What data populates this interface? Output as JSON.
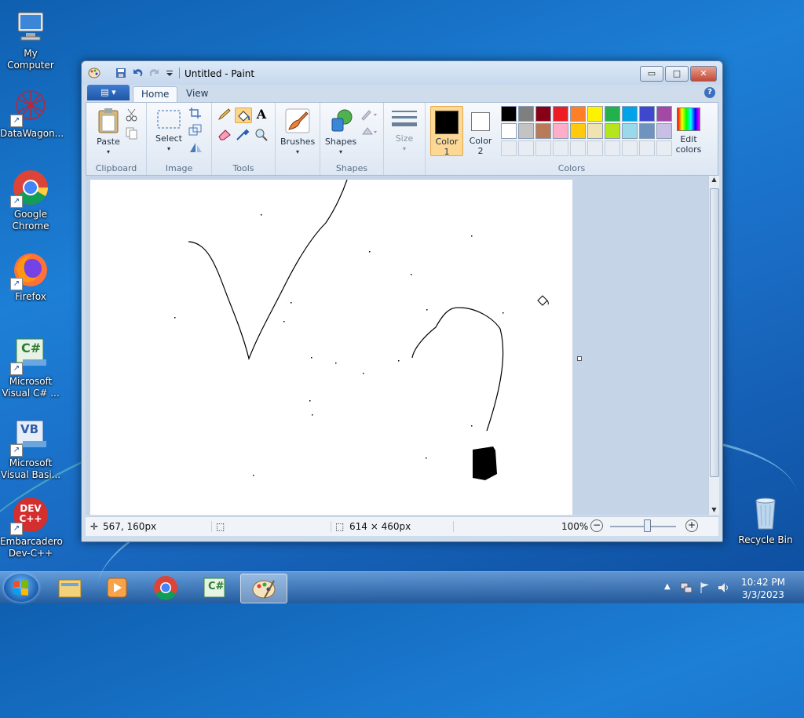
{
  "desktop": {
    "icons": [
      {
        "label": "My Computer",
        "icon": "computer-icon"
      },
      {
        "label": "DataWagon...",
        "icon": "datawagon-icon"
      },
      {
        "label": "Google Chrome",
        "icon": "chrome-icon"
      },
      {
        "label": "Firefox",
        "icon": "firefox-icon"
      },
      {
        "label": "Microsoft Visual C# ...",
        "icon": "visual-csharp-icon"
      },
      {
        "label": "Microsoft Visual Basi...",
        "icon": "visual-basic-icon"
      },
      {
        "label": "Embarcadero Dev-C++",
        "icon": "devcpp-icon"
      },
      {
        "label": "Recycle Bin",
        "icon": "recycle-bin-icon"
      }
    ],
    "devcpp_badge": "DEV C++",
    "csharp_badge": "C#",
    "vb_badge": "VB"
  },
  "paint": {
    "title": "Untitled - Paint",
    "tabs": [
      {
        "label": "Home",
        "active": true
      },
      {
        "label": "View",
        "active": false
      }
    ],
    "help": "?",
    "groups": {
      "clipboard": {
        "label": "Clipboard",
        "paste": "Paste"
      },
      "image": {
        "label": "Image",
        "select": "Select"
      },
      "tools": {
        "label": "Tools",
        "text_tool": "A"
      },
      "brushes": {
        "label": "Brushes"
      },
      "shapes": {
        "label": "Shapes",
        "shapes_label": "Shapes"
      },
      "size": {
        "label": "Size"
      },
      "colors": {
        "label": "Colors",
        "color1": "Color 1",
        "color1_hex": "#000000",
        "color2": "Color 2",
        "color2_hex": "#ffffff",
        "edit_colors": "Edit colors",
        "palette_row1": [
          "#000000",
          "#7f7f7f",
          "#880015",
          "#ed1c24",
          "#ff7f27",
          "#fff200",
          "#22b14c",
          "#00a2e8",
          "#3f48cc",
          "#a349a4"
        ],
        "palette_row2": [
          "#ffffff",
          "#c3c3c3",
          "#b97a57",
          "#ffaec9",
          "#ffc90e",
          "#efe4b0",
          "#b5e61d",
          "#99d9ea",
          "#7092be",
          "#c8bfe7"
        ]
      }
    },
    "status": {
      "cursor_pos": "567, 160px",
      "image_size": "614 × 460px",
      "zoom": "100%",
      "zoom_level": 0.55
    }
  },
  "taskbar": {
    "apps": [
      "explorer-icon",
      "media-player-icon",
      "chrome-icon",
      "visual-csharp-icon",
      "paint-icon"
    ],
    "csharp_badge": "C#",
    "time": "10:42 PM",
    "date": "3/3/2023"
  }
}
